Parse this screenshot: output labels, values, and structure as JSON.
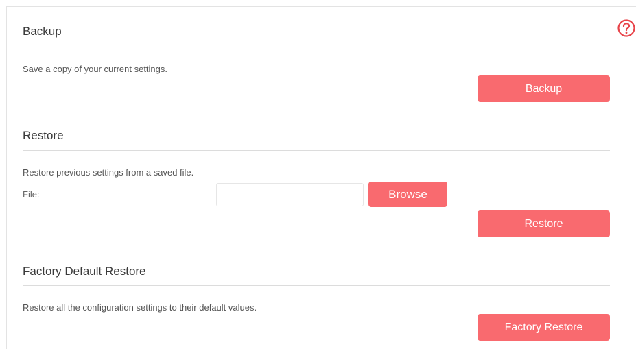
{
  "help": {
    "icon": "question-circle-icon",
    "color": "#e8444a"
  },
  "backup": {
    "title": "Backup",
    "description": "Save a copy of your current settings.",
    "button_label": "Backup"
  },
  "restore": {
    "title": "Restore",
    "description": "Restore previous settings from a saved file.",
    "file_label": "File:",
    "file_value": "",
    "browse_label": "Browse",
    "button_label": "Restore"
  },
  "factory": {
    "title": "Factory Default Restore",
    "description": "Restore all the configuration settings to their default values.",
    "button_label": "Factory Restore"
  },
  "colors": {
    "accent": "#f96a6f",
    "text": "#333333",
    "divider": "#dcdcdc"
  }
}
